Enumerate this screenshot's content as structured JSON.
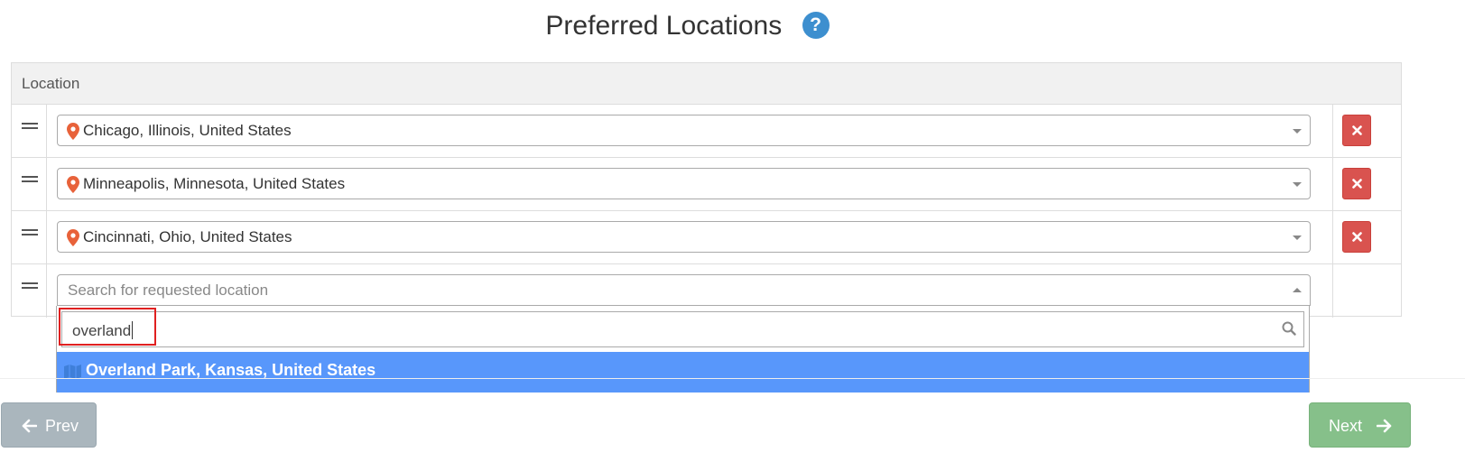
{
  "page": {
    "title": "Preferred Locations",
    "help_symbol": "?"
  },
  "table": {
    "column_header": "Location",
    "rows": [
      {
        "location": "Chicago, Illinois, United States"
      },
      {
        "location": "Minneapolis, Minnesota, United States"
      },
      {
        "location": "Cincinnati, Ohio, United States"
      }
    ],
    "new_row": {
      "placeholder": "Search for requested location"
    }
  },
  "dropdown": {
    "search_value": "overland",
    "results": [
      {
        "label": "Overland Park, Kansas, United States",
        "icon": "map-icon",
        "highlighted": true
      }
    ]
  },
  "footer": {
    "prev_label": "Prev",
    "next_label": "Next"
  },
  "colors": {
    "pin": "#e8623a",
    "remove": "#d9534f",
    "highlight": "#5897fb",
    "help": "#3d8fcf",
    "prev": "#aab6bd",
    "next": "#86c08a",
    "annotation": "#e02020"
  }
}
